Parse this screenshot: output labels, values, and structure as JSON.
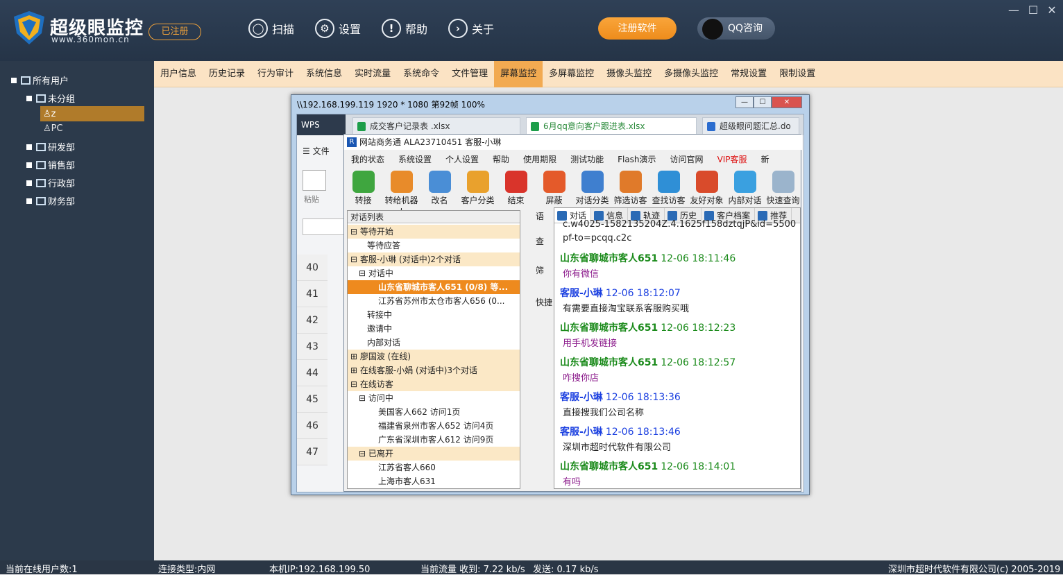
{
  "app": {
    "title": "超级眼监控",
    "url": "www.360mon.cn",
    "registered_badge": "已注册",
    "nav": [
      {
        "label": "扫描",
        "icon": "scan-icon"
      },
      {
        "label": "设置",
        "icon": "gear-icon"
      },
      {
        "label": "帮助",
        "icon": "help-icon"
      },
      {
        "label": "关于",
        "icon": "about-icon"
      }
    ],
    "register_button": "注册软件",
    "qq_button": "QQ咨询",
    "window_controls": {
      "minimize": "—",
      "maximize": "☐",
      "close": "✕"
    }
  },
  "sidebar": {
    "root": "所有用户",
    "groups": [
      {
        "label": "未分组"
      },
      {
        "label": "研发部"
      },
      {
        "label": "销售部"
      },
      {
        "label": "行政部"
      },
      {
        "label": "财务部"
      }
    ],
    "users": [
      {
        "label": "z"
      },
      {
        "label": "PC"
      }
    ]
  },
  "tabs": [
    "用户信息",
    "历史记录",
    "行为审计",
    "系统信息",
    "实时流量",
    "系统命令",
    "文件管理",
    "屏幕监控",
    "多屏幕监控",
    "摄像头监控",
    "多摄像头监控",
    "常规设置",
    "限制设置"
  ],
  "active_tab": "屏幕监控",
  "remote_window": {
    "title": "\\\\192.168.199.119 1920 * 1080 第92帧 100%"
  },
  "wps": {
    "logo": "WPS",
    "tabs": [
      "成交客户记录表 .xlsx",
      "6月qq意向客户跟进表.xlsx",
      "超级眼问题汇总.do"
    ],
    "file_menu": "文件",
    "paste": "粘贴",
    "row_numbers": [
      "40",
      "41",
      "42",
      "43",
      "44",
      "45",
      "46",
      "47"
    ]
  },
  "chat_app": {
    "title": "网站商务通  ALA23710451 客服-小琳",
    "menu": [
      "我的状态",
      "系统设置",
      "个人设置",
      "帮助",
      "使用期限",
      "测试功能",
      "Flash演示",
      "访问官网",
      "VIP客服",
      "新"
    ],
    "tools": [
      {
        "label": "转接",
        "color": "#3fa63f"
      },
      {
        "label": "转给机器人",
        "color": "#e88b2a"
      },
      {
        "label": "改名",
        "color": "#4a8ed6"
      },
      {
        "label": "客户分类",
        "color": "#e9a12d"
      },
      {
        "label": "结束",
        "color": "#d9342b"
      },
      {
        "label": "屏蔽",
        "color": "#e45a2a"
      },
      {
        "label": "对话分类",
        "color": "#3f7fcf"
      },
      {
        "label": "筛选访客",
        "color": "#e07a2a"
      },
      {
        "label": "查找访客",
        "color": "#2f8fd6"
      },
      {
        "label": "友好对象",
        "color": "#d94b2b"
      },
      {
        "label": "内部对话",
        "color": "#3aa0e0"
      },
      {
        "label": "快速查询",
        "color": "#9bb4cc"
      }
    ],
    "conv_list_header": "对话列表",
    "conv_items": [
      {
        "text": "⊟ 等待开始",
        "style": "grp",
        "indent": 0
      },
      {
        "text": "等待应答",
        "style": "",
        "indent": 24
      },
      {
        "text": "⊟ 客服-小琳 (对话中)2个对话",
        "style": "grp",
        "indent": 0
      },
      {
        "text": "⊟ 对话中",
        "style": "",
        "indent": 12
      },
      {
        "text": "山东省聊城市客人651  (0/8)  等...",
        "style": "hl",
        "indent": 40
      },
      {
        "text": "江苏省苏州市太仓市客人656  (0...",
        "style": "",
        "indent": 40
      },
      {
        "text": "转接中",
        "style": "",
        "indent": 24
      },
      {
        "text": "邀请中",
        "style": "",
        "indent": 24
      },
      {
        "text": "内部对话",
        "style": "",
        "indent": 24
      },
      {
        "text": "⊞ 廖国波 (在线)",
        "style": "grp",
        "indent": 0
      },
      {
        "text": "⊞ 在线客服-小娟 (对话中)3个对话",
        "style": "grp",
        "indent": 0
      },
      {
        "text": "⊟ 在线访客",
        "style": "grp",
        "indent": 0
      },
      {
        "text": "⊟ 访问中",
        "style": "",
        "indent": 12
      },
      {
        "text": "美国客人662 访问1页",
        "style": "",
        "indent": 40
      },
      {
        "text": "福建省泉州市客人652 访问4页",
        "style": "",
        "indent": 40
      },
      {
        "text": "广东省深圳市客人612 访问9页",
        "style": "",
        "indent": 40
      },
      {
        "text": "⊟ 已离开",
        "style": "grp",
        "indent": 12
      },
      {
        "text": "江苏省客人660",
        "style": "",
        "indent": 40
      },
      {
        "text": "上海市客人631",
        "style": "",
        "indent": 40
      }
    ],
    "mid_labels": [
      "语",
      "查",
      "筛",
      "快捷"
    ],
    "chat_tabs": [
      "对话",
      "信息",
      "轨迹",
      "历史",
      "客户档案",
      "推荐"
    ],
    "messages_top": [
      "c.w4025-1582135204Z.4.1625f158dztqjP&id=5500",
      "pf-to=pcqq.c2c"
    ],
    "messages": [
      {
        "sender": "山东省聊城市客人651",
        "time": "12-06 18:11:46",
        "text": "你有微信",
        "role": "customer"
      },
      {
        "sender": "客服-小琳",
        "time": "12-06 18:12:07",
        "text": "有需要直接淘宝联系客服购买哦",
        "role": "agent"
      },
      {
        "sender": "山东省聊城市客人651",
        "time": "12-06 18:12:23",
        "text": "用手机发链接",
        "role": "customer"
      },
      {
        "sender": "山东省聊城市客人651",
        "time": "12-06 18:12:57",
        "text": "咋搜你店",
        "role": "customer"
      },
      {
        "sender": "客服-小琳",
        "time": "12-06 18:13:36",
        "text": "直接搜我们公司名称",
        "role": "agent"
      },
      {
        "sender": "客服-小琳",
        "time": "12-06 18:13:46",
        "text": "深圳市超时代软件有限公司",
        "role": "agent"
      },
      {
        "sender": "山东省聊城市客人651",
        "time": "12-06 18:14:01",
        "text": "有吗",
        "role": "customer"
      }
    ]
  },
  "status": {
    "online_users": "当前在线用户数:1",
    "conn_type": "连接类型:内网",
    "local_ip": "本机IP:192.168.199.50",
    "traffic_recv": "当前流量 收到: 7.22 kb/s",
    "traffic_send": "发送: 0.17 kb/s",
    "copyright": "深圳市超时代软件有限公司(c) 2005-2019"
  }
}
